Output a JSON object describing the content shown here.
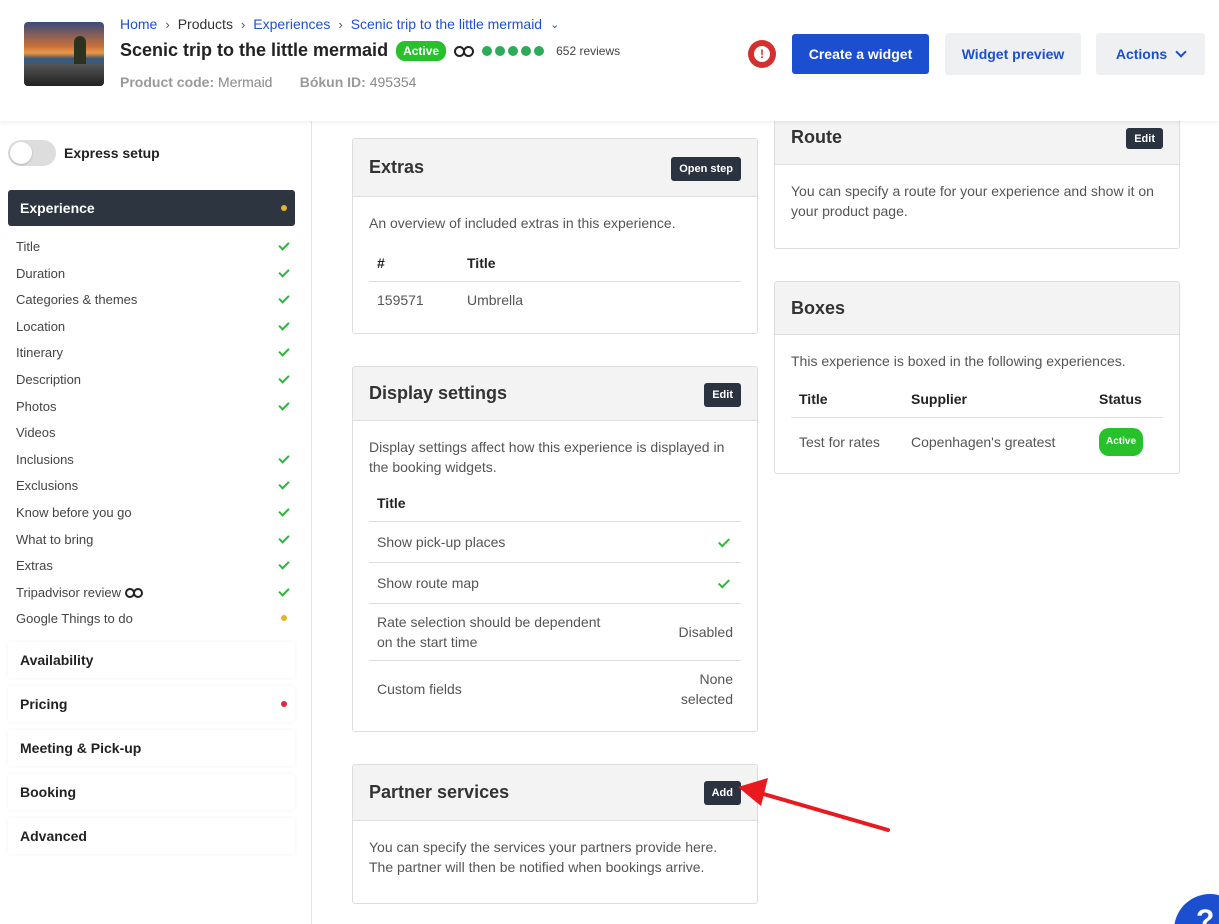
{
  "header": {
    "breadcrumb": [
      "Home",
      "Products",
      "Experiences",
      "Scenic trip to the little mermaid"
    ],
    "title": "Scenic trip to the little mermaid",
    "status": "Active",
    "rating_dots": 5,
    "reviews": "652 reviews",
    "product_code_label": "Product code:",
    "product_code": "Mermaid",
    "bokun_id_label": "Bókun ID:",
    "bokun_id": "495354",
    "create_widget": "Create a widget",
    "widget_preview": "Widget preview",
    "actions": "Actions"
  },
  "sidebar": {
    "express_setup": "Express setup",
    "sections": {
      "experience": "Experience",
      "availability": "Availability",
      "pricing": "Pricing",
      "meeting": "Meeting & Pick-up",
      "booking": "Booking",
      "advanced": "Advanced"
    },
    "items": [
      {
        "label": "Title",
        "status": "check"
      },
      {
        "label": "Duration",
        "status": "check"
      },
      {
        "label": "Categories & themes",
        "status": "check"
      },
      {
        "label": "Location",
        "status": "check"
      },
      {
        "label": "Itinerary",
        "status": "check"
      },
      {
        "label": "Description",
        "status": "check"
      },
      {
        "label": "Photos",
        "status": "check"
      },
      {
        "label": "Videos",
        "status": "none"
      },
      {
        "label": "Inclusions",
        "status": "check"
      },
      {
        "label": "Exclusions",
        "status": "check"
      },
      {
        "label": "Know before you go",
        "status": "check"
      },
      {
        "label": "What to bring",
        "status": "check"
      },
      {
        "label": "Extras",
        "status": "check"
      },
      {
        "label": "Tripadvisor review",
        "status": "check"
      },
      {
        "label": "Google Things to do",
        "status": "pending"
      }
    ]
  },
  "extras": {
    "title": "Extras",
    "button": "Open step",
    "description": "An overview of included extras in this experience.",
    "col_num": "#",
    "col_title": "Title",
    "rows": [
      {
        "id": "159571",
        "title": "Umbrella"
      }
    ]
  },
  "display_settings": {
    "title": "Display settings",
    "button": "Edit",
    "description": "Display settings affect how this experience is displayed in the booking widgets.",
    "col_title": "Title",
    "rows": [
      {
        "label": "Show pick-up places",
        "value": ""
      },
      {
        "label": "Show route map",
        "value": ""
      },
      {
        "label": "Rate selection should be dependent on the start time",
        "value": "Disabled"
      },
      {
        "label": "Custom fields",
        "value": "None selected"
      }
    ]
  },
  "partner_services": {
    "title": "Partner services",
    "button": "Add",
    "description": "You can specify the services your partners provide here. The partner will then be notified when bookings arrive."
  },
  "route": {
    "title": "Route",
    "button": "Edit",
    "description": "You can specify a route for your experience and show it on your product page."
  },
  "boxes": {
    "title": "Boxes",
    "description": "This experience is boxed in the following experiences.",
    "col_title": "Title",
    "col_supplier": "Supplier",
    "col_status": "Status",
    "rows": [
      {
        "title": "Test for rates",
        "supplier": "Copenhagen's greatest",
        "status": "Active"
      }
    ]
  },
  "help_button": "?",
  "colors": {
    "primary": "#1c4fcf",
    "active_green": "#27c12c",
    "alert_red": "#d3302f",
    "dark": "#2d3540",
    "annotation_arrow": "#e8191f"
  }
}
